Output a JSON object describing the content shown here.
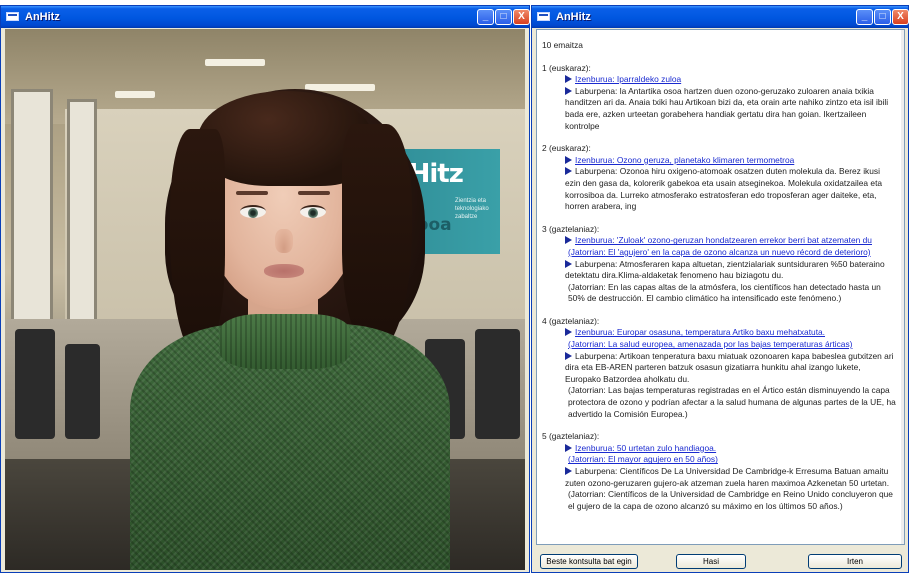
{
  "left_window": {
    "title": "AnHitz",
    "controls": {
      "minimize": "_",
      "maximize": "□",
      "close": "X"
    },
    "poster": {
      "title": "AnHitz",
      "subtitle": "Zientzia eta teknologiako zabaltze",
      "footer": "Prototipoa"
    }
  },
  "right_window": {
    "title": "AnHitz",
    "controls": {
      "minimize": "_",
      "maximize": "□",
      "close": "X"
    },
    "count": "10 emaitza",
    "results": [
      {
        "head": "1 (euskaraz):",
        "title_label": "Izenburua: Iparraldeko zuloa",
        "summary": "Laburpena: la Antartika osoa hartzen duen ozono-geruzako zuloaren anaia txikia handitzen ari da. Anaia txiki hau Artikoan bizi da, eta orain arte nahiko zintzo eta isil ibili bada ere, azken urteetan gorabehera handiak gertatu dira han goian. Ikertzaileen kontrolpe"
      },
      {
        "head": "2 (euskaraz):",
        "title_label": "Izenburua: Ozono geruza, planetako klimaren termometroa",
        "summary": "Laburpena: Ozonoa hiru oxigeno-atomoak osatzen duten molekula da. Berez ikusi ezin den gasa da, kolorerik gabekoa eta usain atseginekoa. Molekula oxidatzailea eta korrosiboa da. Lurreko atmosferako estratosferan edo troposferan ager daiteke, eta, horren arabera, ing"
      },
      {
        "head": "3 (gaztelaniaz):",
        "title_label": "Izenburua: 'Zuloak' ozono-geruzan hondatzearen errekor berri bat atzematen du",
        "title_original": "(Jatorrian: El 'agujero' en la capa de ozono alcanza un nuevo récord de deterioro)",
        "summary": "Laburpena: Atmosferaren kapa altuetan, zientzialariak suntsiduraren %50 bateraino detektatu dira.Klima-aldaketak fenomeno hau biziagotu du.",
        "summary_original": "(Jatorrian: En las capas altas de la atmósfera, los científicos han detectado hasta un 50% de destrucción. El cambio climático ha intensificado este fenómeno.)"
      },
      {
        "head": "4 (gaztelaniaz):",
        "title_label": "Izenburua: Europar osasuna, temperatura Artiko baxu mehatxatuta.",
        "title_original": "(Jatorrian: La salud europea, amenazada por las bajas temperaturas árticas)",
        "summary": "Laburpena: Artikoan tenperatura baxu miatuak ozonoaren kapa babeslea gutxitzen ari dira eta EB-AREN parteren batzuk osasun gizatiarra hunkitu ahal izango lukete, Europako Batzordea aholkatu du.",
        "summary_original": "(Jatorrian: Las bajas temperaturas registradas en el Ártico están disminuyendo la capa protectora de ozono y podrían afectar a la salud humana de algunas partes de la UE, ha advertido la Comisión Europea.)"
      },
      {
        "head": "5 (gaztelaniaz):",
        "title_label": "Izenburua: 50 urtetan zulo handiagoa.",
        "title_original": "(Jatorrian: El mayor agujero en 50 años)",
        "summary": "Laburpena: Científicos De La Universidad De Cambridge-k Erresuma Batuan amaitu zuten ozono-geruzaren gujero-ak atzeman zuela haren maximoa Azkenetan 50 urtetan.",
        "summary_original": "(Jatorrian: Científicos de la Universidad de Cambridge en Reino Unido concluyeron que el gujero de la capa de ozono alcanzó su máximo en los últimos 50 años.)"
      }
    ],
    "buttons": {
      "new_query": "Beste kontsulta bat egin",
      "start": "Hasi",
      "exit": "Irten"
    }
  }
}
